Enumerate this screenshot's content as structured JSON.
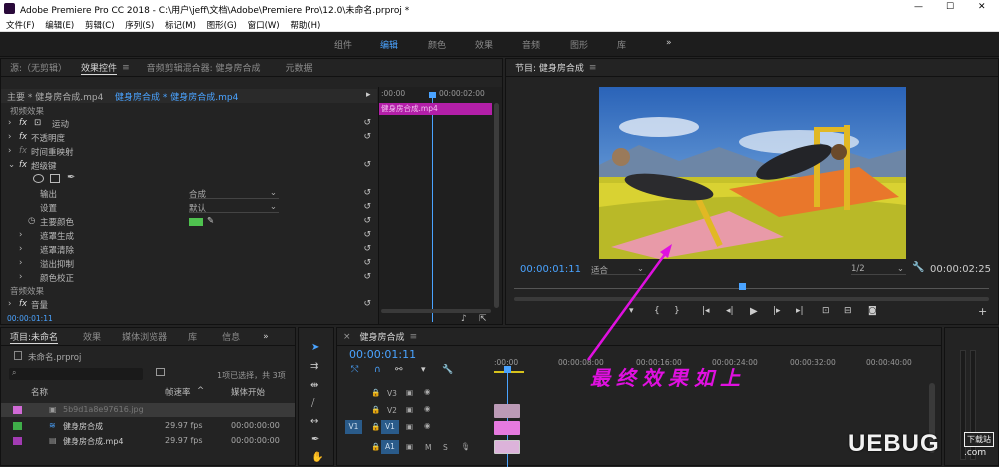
{
  "titlebar": {
    "title": "Adobe Premiere Pro CC 2018 - C:\\用户\\jeff\\文档\\Adobe\\Premiere Pro\\12.0\\未命名.prproj *",
    "minimize": "—",
    "maximize": "☐",
    "close": "✕"
  },
  "menu": [
    "文件(F)",
    "编辑(E)",
    "剪辑(C)",
    "序列(S)",
    "标记(M)",
    "图形(G)",
    "窗口(W)",
    "帮助(H)"
  ],
  "workspaces": [
    "组件",
    "编辑",
    "颜色",
    "效果",
    "音频",
    "图形",
    "库"
  ],
  "workspace_more": "»",
  "effects_panel": {
    "tabs": [
      "源:（无剪辑）",
      "效果控件",
      "音频剪辑混合器: 健身房合成",
      "元数据"
    ],
    "menu_glyph": "≡",
    "header_left": "主要 * 健身房合成.mp4",
    "header_right": "健身房合成 * 健身房合成.mp4",
    "section_video": "视频效果",
    "rows": [
      {
        "fx": "fx",
        "label": "运动"
      },
      {
        "fx": "fx",
        "label": "不透明度"
      },
      {
        "fx": "fx",
        "label": "时间重映射"
      },
      {
        "fx": "fx",
        "label": "超级键"
      }
    ],
    "output_label": "输出",
    "output_value": "合成",
    "setting_label": "设置",
    "setting_value": "默认",
    "key_color_label": "主要颜色",
    "key_color": "#4fc24f",
    "sub": [
      "遮罩生成",
      "遮罩清除",
      "溢出抑制",
      "颜色校正"
    ],
    "section_audio": "音频效果",
    "audio_row": "音量",
    "timecode": "00:00:01:11",
    "mini_timeline": {
      "t0": ":00:00",
      "t1": "00:00:02:00",
      "clip": "健身房合成.mp4"
    }
  },
  "program": {
    "title": "节目: 健身房合成",
    "menu_glyph": "≡",
    "timecode": "00:00:01:11",
    "fit": "适合",
    "resolution": "1/2",
    "duration": "00:00:02:25",
    "annotation": "最终效果如上"
  },
  "project": {
    "tabs": [
      "项目:未命名",
      "效果",
      "媒体浏览器",
      "库",
      "信息"
    ],
    "more": "»",
    "filename": "未命名.prproj",
    "status": "1项已选择，共 3项",
    "columns": [
      "名称",
      "帧速率",
      "媒体开始"
    ],
    "items": [
      {
        "swatch": "#d06ad6",
        "name": "5b9d1a8e97616.jpg",
        "fps": "",
        "start": ""
      },
      {
        "swatch": "#3fae49",
        "name": "健身房合成",
        "fps": "29.97 fps",
        "start": "00:00:00:00"
      },
      {
        "swatch": "#a23bb3",
        "name": "健身房合成.mp4",
        "fps": "29.97 fps",
        "start": "00:00:00:00"
      }
    ]
  },
  "timeline": {
    "title": "健身房合成",
    "menu_glyph": "≡",
    "close": "×",
    "timecode": "00:00:01:11",
    "ruler": [
      ":00:00",
      "00:00:08:00",
      "00:00:16:00",
      "00:00:24:00",
      "00:00:32:00",
      "00:00:40:00"
    ],
    "tracks": [
      {
        "name": "V3"
      },
      {
        "name": "V2"
      },
      {
        "name": "V1",
        "src": "V1"
      },
      {
        "name": "A1",
        "src": "A1"
      }
    ],
    "track_buttons": [
      "M",
      "S"
    ]
  },
  "watermark": {
    "text": "UEBUG",
    "suffix": ".com",
    "badge": "下载站"
  },
  "colors": {
    "accent": "#4aa3ff",
    "magenta": "#e010e0",
    "clip_pink": "#e67adf"
  }
}
